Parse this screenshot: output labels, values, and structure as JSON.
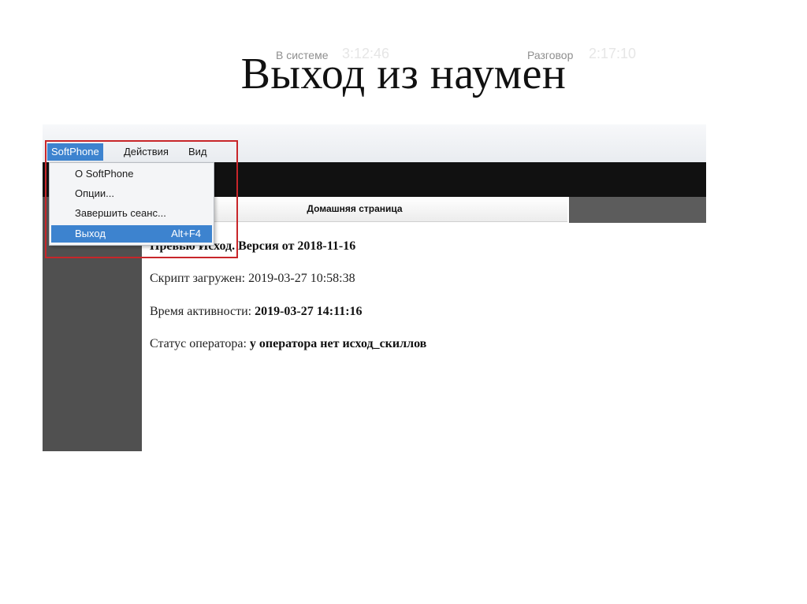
{
  "slide": {
    "title": "Выход из наумен"
  },
  "menubar": {
    "items": [
      "SoftPhone",
      "Действия",
      "Вид"
    ],
    "active_item": "SoftPhone"
  },
  "menu": {
    "items": [
      {
        "label": "О SoftPhone",
        "shortcut": ""
      },
      {
        "label": "Опции...",
        "shortcut": ""
      },
      {
        "label": "Завершить сеанс...",
        "shortcut": ""
      },
      {
        "label": "Выход",
        "shortcut": "Alt+F4"
      }
    ],
    "highlighted_item": "Выход"
  },
  "status": {
    "in_system_label": "В системе",
    "in_system_value": "3:12:46",
    "call_label": "Разговор",
    "call_value": "2:17:10"
  },
  "tabs": {
    "home": "Домашняя страница"
  },
  "content": {
    "line1_bold": "Превью Исход. Версия от 2018-11-16",
    "line2_label": "Скрипт загружен:",
    "line2_value": "2019-03-27 10:58:38",
    "line3_label": "Время активности:",
    "line3_value": "2019-03-27 14:11:16",
    "line4_label": "Статус оператора:",
    "line4_value": "у оператора нет исход_скиллов"
  },
  "colors": {
    "menu_highlight": "#3d83cf",
    "annotation_frame": "#c8262a",
    "status_bar": "#111111",
    "sidebar": "#505050"
  }
}
